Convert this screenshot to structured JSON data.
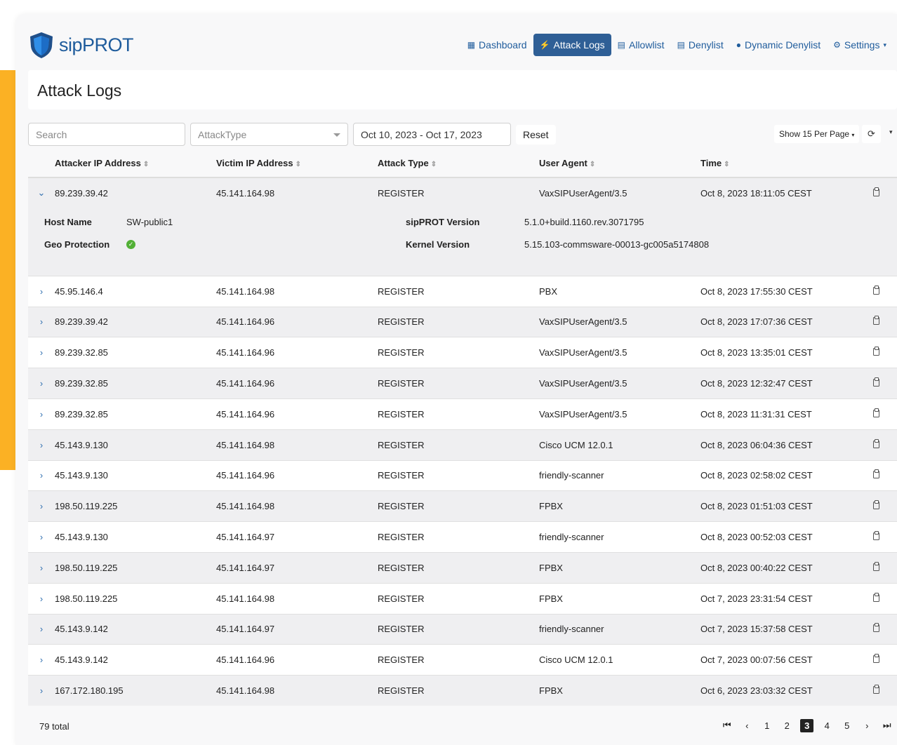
{
  "brand": {
    "name": "sipPROT",
    "accent_color": "#fbb124",
    "primary_color": "#2f5f96"
  },
  "nav": [
    {
      "label": "Dashboard",
      "icon": "dashboard-icon",
      "active": false
    },
    {
      "label": "Attack Logs",
      "icon": "bolt-icon",
      "active": true
    },
    {
      "label": "Allowlist",
      "icon": "file-icon",
      "active": false
    },
    {
      "label": "Denylist",
      "icon": "file-icon",
      "active": false
    },
    {
      "label": "Dynamic Denylist",
      "icon": "bomb-icon",
      "active": false
    },
    {
      "label": "Settings",
      "icon": "gear-icon",
      "active": false
    }
  ],
  "page": {
    "title": "Attack Logs"
  },
  "toolbar": {
    "search_placeholder": "Search",
    "attack_type_placeholder": "AttackType",
    "date_range": "Oct 10, 2023 - Oct 17, 2023",
    "reset_label": "Reset",
    "per_page_label": "Show 15 Per Page"
  },
  "table": {
    "headers": [
      "Attacker IP Address",
      "Victim IP Address",
      "Attack Type",
      "User Agent",
      "Time"
    ],
    "expanded_row": {
      "attacker_ip": "89.239.39.42",
      "victim_ip": "45.141.164.98",
      "attack_type": "REGISTER",
      "user_agent": "VaxSIPUserAgent/3.5",
      "time": "Oct 8, 2023 18:11:05 CEST",
      "details": {
        "host_name_label": "Host Name",
        "host_name": "SW-public1",
        "geo_label": "Geo Protection",
        "geo_status": "enabled",
        "version_label": "sipPROT Version",
        "version": "5.1.0+build.1160.rev.3071795",
        "kernel_label": "Kernel Version",
        "kernel": "5.15.103-commsware-00013-gc005a5174808"
      }
    },
    "rows": [
      [
        "45.95.146.4",
        "45.141.164.98",
        "REGISTER",
        "PBX",
        "Oct 8, 2023 17:55:30 CEST"
      ],
      [
        "89.239.39.42",
        "45.141.164.96",
        "REGISTER",
        "VaxSIPUserAgent/3.5",
        "Oct 8, 2023 17:07:36 CEST"
      ],
      [
        "89.239.32.85",
        "45.141.164.96",
        "REGISTER",
        "VaxSIPUserAgent/3.5",
        "Oct 8, 2023 13:35:01 CEST"
      ],
      [
        "89.239.32.85",
        "45.141.164.96",
        "REGISTER",
        "VaxSIPUserAgent/3.5",
        "Oct 8, 2023 12:32:47 CEST"
      ],
      [
        "89.239.32.85",
        "45.141.164.96",
        "REGISTER",
        "VaxSIPUserAgent/3.5",
        "Oct 8, 2023 11:31:31 CEST"
      ],
      [
        "45.143.9.130",
        "45.141.164.98",
        "REGISTER",
        "Cisco UCM 12.0.1",
        "Oct 8, 2023 06:04:36 CEST"
      ],
      [
        "45.143.9.130",
        "45.141.164.96",
        "REGISTER",
        "friendly-scanner",
        "Oct 8, 2023 02:58:02 CEST"
      ],
      [
        "198.50.119.225",
        "45.141.164.98",
        "REGISTER",
        "FPBX",
        "Oct 8, 2023 01:51:03 CEST"
      ],
      [
        "45.143.9.130",
        "45.141.164.97",
        "REGISTER",
        "friendly-scanner",
        "Oct 8, 2023 00:52:03 CEST"
      ],
      [
        "198.50.119.225",
        "45.141.164.97",
        "REGISTER",
        "FPBX",
        "Oct 8, 2023 00:40:22 CEST"
      ],
      [
        "198.50.119.225",
        "45.141.164.98",
        "REGISTER",
        "FPBX",
        "Oct 7, 2023 23:31:54 CEST"
      ],
      [
        "45.143.9.142",
        "45.141.164.97",
        "REGISTER",
        "friendly-scanner",
        "Oct 7, 2023 15:37:58 CEST"
      ],
      [
        "45.143.9.142",
        "45.141.164.96",
        "REGISTER",
        "Cisco UCM 12.0.1",
        "Oct 7, 2023 00:07:56 CEST"
      ],
      [
        "167.172.180.195",
        "45.141.164.98",
        "REGISTER",
        "FPBX",
        "Oct 6, 2023 23:03:32 CEST"
      ]
    ]
  },
  "footer": {
    "total": "79 total",
    "pages": [
      "1",
      "2",
      "3",
      "4",
      "5"
    ],
    "current_page": "3"
  }
}
